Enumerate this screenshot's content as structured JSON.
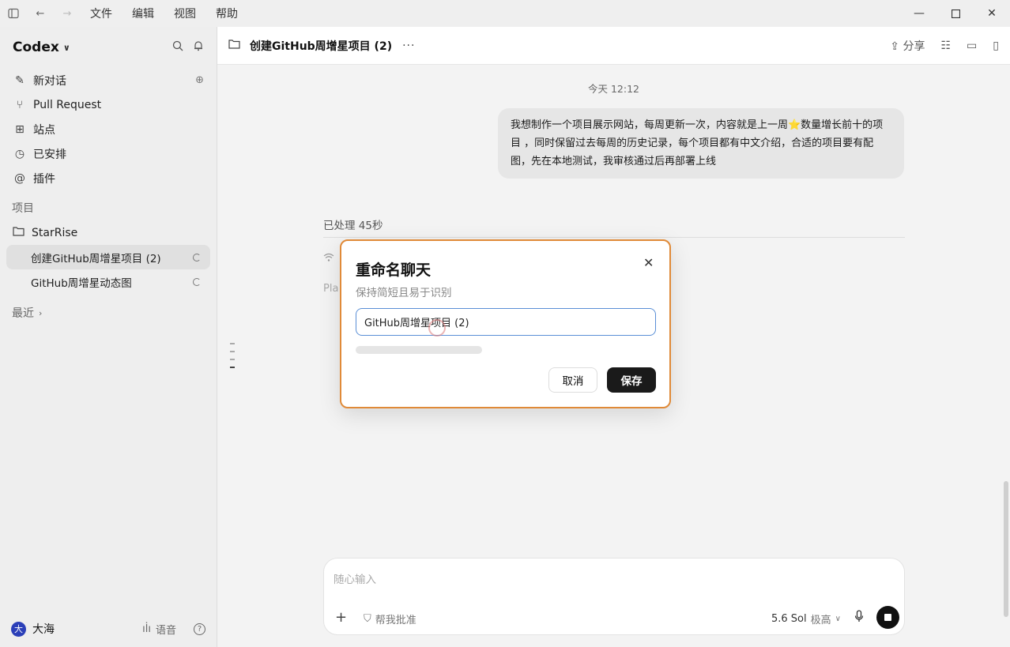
{
  "menubar": {
    "menus": [
      "文件",
      "编辑",
      "视图",
      "帮助"
    ]
  },
  "sidebar": {
    "brand": "Codex",
    "items": [
      {
        "label": "新对话",
        "icon": "edit-icon"
      },
      {
        "label": "Pull Request",
        "icon": "pull-request-icon"
      },
      {
        "label": "站点",
        "icon": "sites-icon"
      },
      {
        "label": "已安排",
        "icon": "clock-icon"
      },
      {
        "label": "插件",
        "icon": "at-icon"
      }
    ],
    "section_projects": "项目",
    "project_name": "StarRise",
    "chats": [
      {
        "label": "创建GitHub周增星项目 (2)",
        "active": true
      },
      {
        "label": "GitHub周增星动态图",
        "active": false
      }
    ],
    "recent": "最近",
    "user": {
      "avatar": "大",
      "name": "大海"
    },
    "voice_label": "语音"
  },
  "header": {
    "title": "创建GitHub周增星项目 (2)",
    "share": "分享"
  },
  "conversation": {
    "timestamp": "今天 12:12",
    "user_message": "我想制作一个项目展示网站，每周更新一次，内容就是上一周⭐数量增长前十的项目 ，同时保留过去每周的历史记录，每个项目都有中文介绍，合适的项目要有配图，先在本地测试，我审核通过后再部署上线",
    "processed": "已处理 45秒",
    "ghost_text": "Pla"
  },
  "composer": {
    "placeholder": "随心输入",
    "approve": "帮我批准",
    "model": "5.6 Sol",
    "level": "极高"
  },
  "dialog": {
    "title": "重命名聊天",
    "subtitle": "保持简短且易于识别",
    "input_value": "GitHub周增星项目 (2)",
    "cancel": "取消",
    "save": "保存"
  },
  "colors": {
    "dialog_border": "#e08a38",
    "input_focus": "#5a8fd6",
    "save_button": "#1a1a1a",
    "avatar": "#2b3fb8"
  }
}
